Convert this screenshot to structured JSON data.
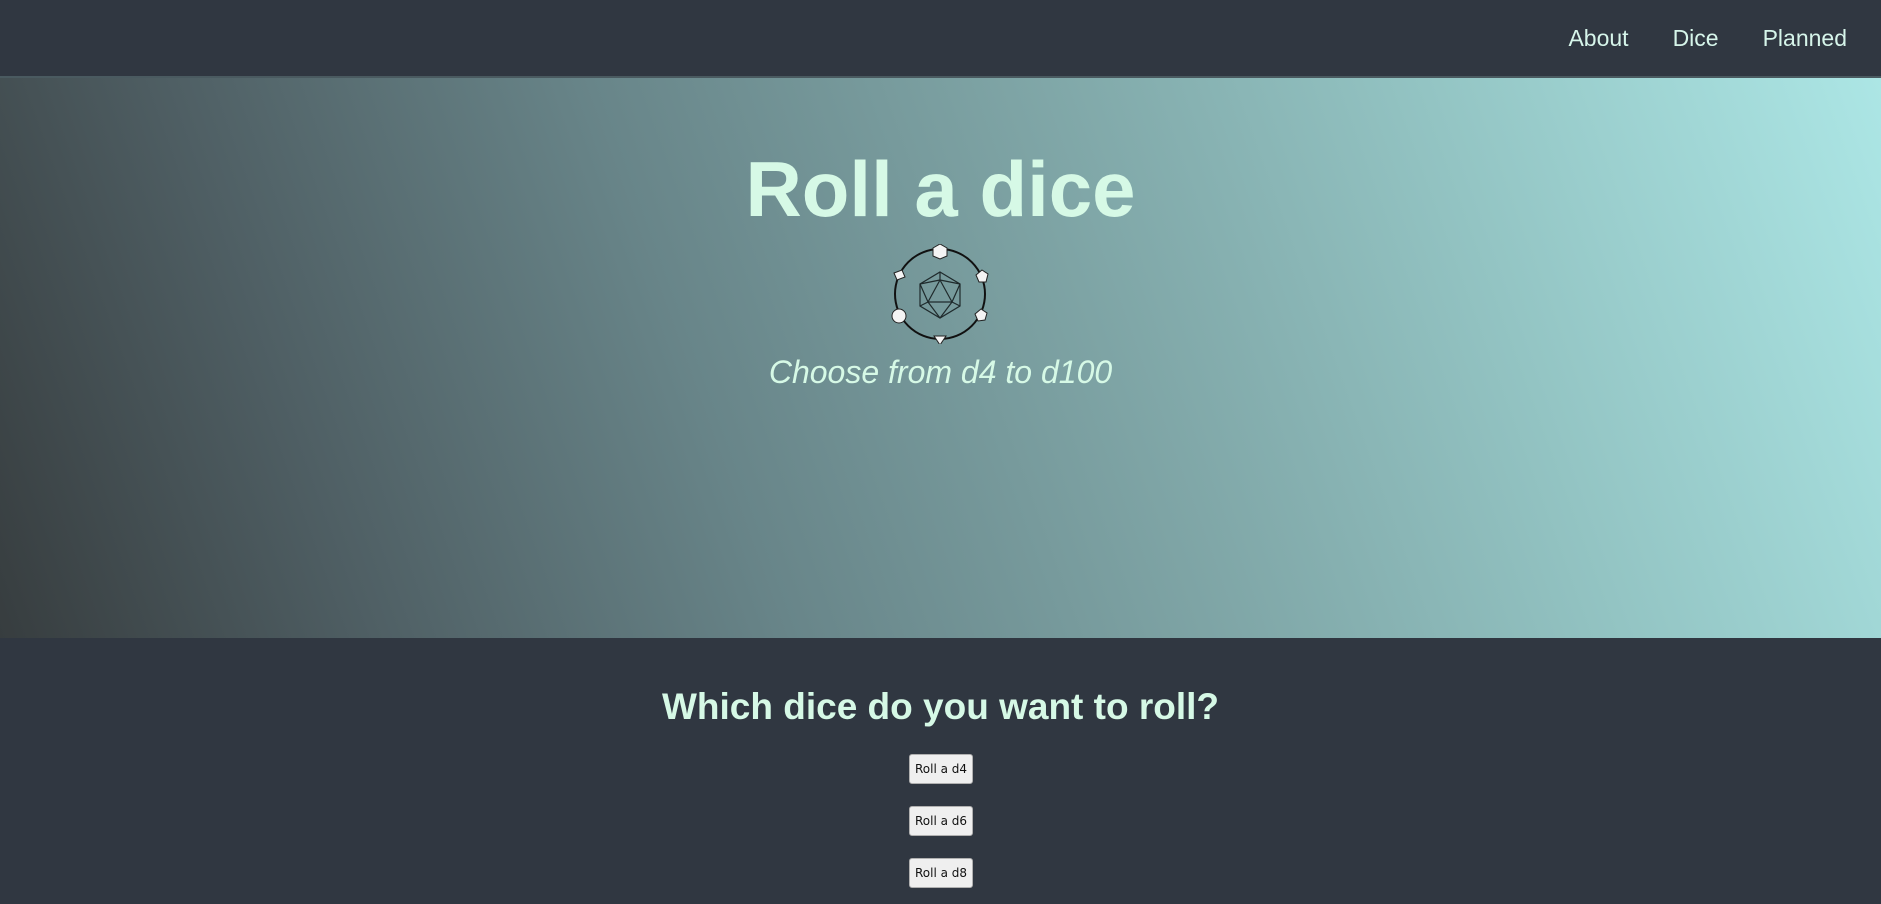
{
  "nav": {
    "links": [
      {
        "label": "About"
      },
      {
        "label": "Dice"
      },
      {
        "label": "Planned"
      }
    ]
  },
  "hero": {
    "title": "Roll a dice",
    "subtitle": "Choose from d4 to d100",
    "logo_icon": "dice-set-icon"
  },
  "dice_section": {
    "title": "Which dice do you want to roll?",
    "buttons": [
      {
        "label": "Roll a d4"
      },
      {
        "label": "Roll a d6"
      },
      {
        "label": "Roll a d8"
      }
    ]
  },
  "colors": {
    "background": "#303741",
    "accent_text": "#d6f9e6",
    "gradient_start": "#373d3f",
    "gradient_end": "#ace6e5"
  }
}
